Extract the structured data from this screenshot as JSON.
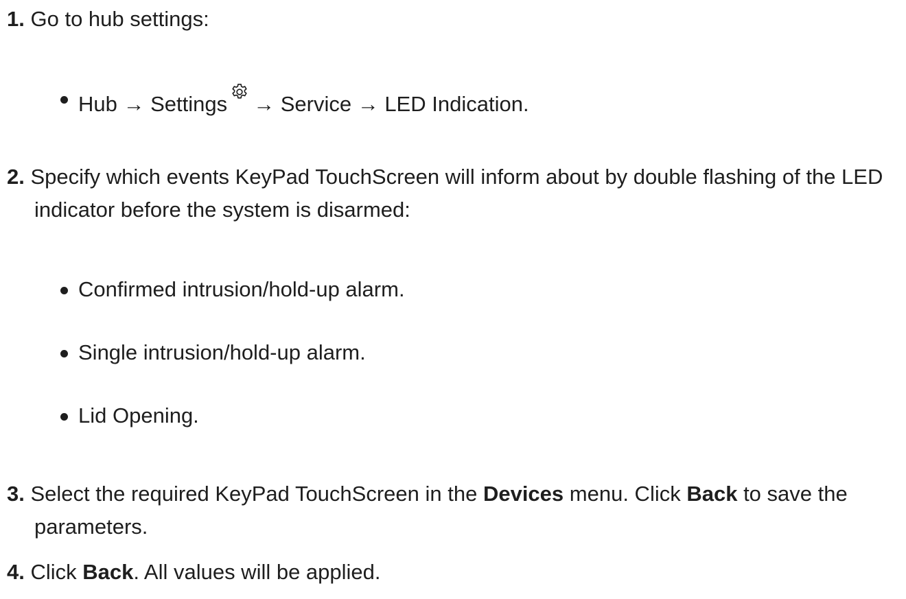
{
  "steps": [
    {
      "number": "1.",
      "text": "Go to hub settings:",
      "bullets": [
        {
          "parts": [
            "Hub → Settings",
            "→ Service → LED Indication."
          ],
          "icon": "gear-icon"
        }
      ]
    },
    {
      "number": "2.",
      "text": "Specify which events KeyPad TouchScreen will inform about by double flashing of the LED indicator before the system is disarmed:",
      "bullets": [
        {
          "text": "Confirmed intrusion/hold-up alarm."
        },
        {
          "text": "Single intrusion/hold-up alarm."
        },
        {
          "text": "Lid Opening."
        }
      ]
    },
    {
      "number": "3.",
      "parts": [
        "Select the required KeyPad TouchScreen in the ",
        "Devices",
        " menu. Click ",
        "Back",
        " to save the parameters."
      ]
    },
    {
      "number": "4.",
      "parts": [
        "Click ",
        "Back",
        ". All values will be applied."
      ]
    }
  ]
}
